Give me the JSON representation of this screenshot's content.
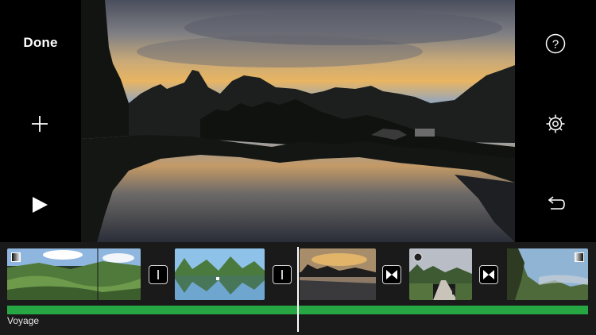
{
  "toolbar": {
    "done_label": "Done",
    "left_icons": [
      "add-media-icon",
      "play-icon"
    ],
    "right_icons": [
      "help-icon",
      "settings-gear-icon",
      "undo-icon"
    ],
    "help_glyph": "?"
  },
  "timeline": {
    "clips": [
      "landscape-terraces",
      "river-karst-reflection",
      "sunset-river",
      "village-road",
      "mountain-valley"
    ],
    "transitions": [
      "none",
      "none",
      "theme",
      "theme"
    ],
    "audio_track_label": "Voyage",
    "colors": {
      "audio_track": "#27a744",
      "background": "#1a1a1a"
    }
  }
}
